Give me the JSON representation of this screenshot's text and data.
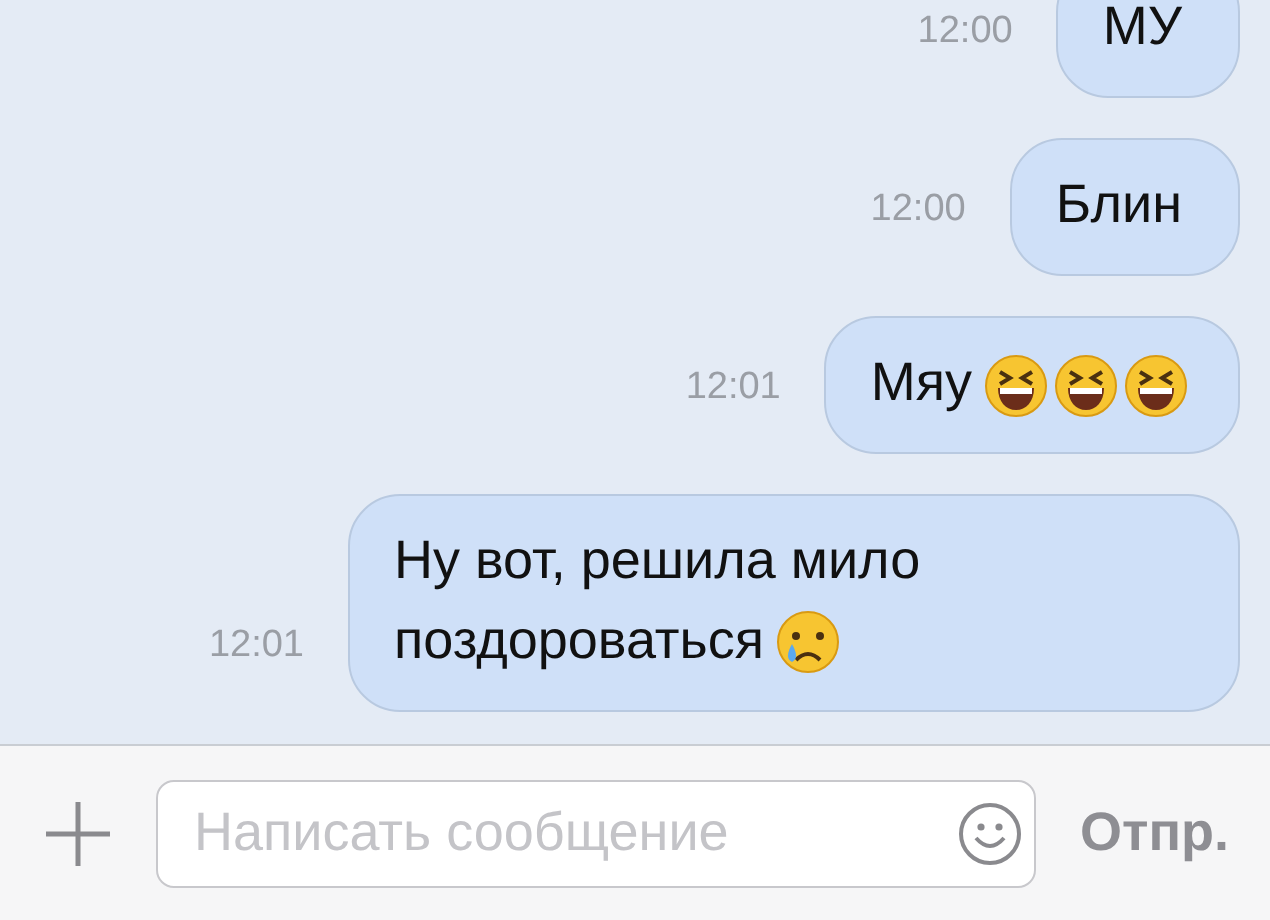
{
  "messages": [
    {
      "time": "12:00",
      "text": "МУ"
    },
    {
      "time": "12:00",
      "text": "Блин"
    },
    {
      "time": "12:01",
      "text": "Мяу",
      "emoji": [
        {
          "kind": "laughing"
        },
        {
          "kind": "laughing"
        },
        {
          "kind": "laughing"
        }
      ]
    },
    {
      "time": "12:01",
      "text": "Ну вот, решила мило поздороваться",
      "emoji": [
        {
          "kind": "crying"
        }
      ]
    }
  ],
  "composer": {
    "placeholder": "Написать сообщение",
    "send": "Отпр."
  }
}
